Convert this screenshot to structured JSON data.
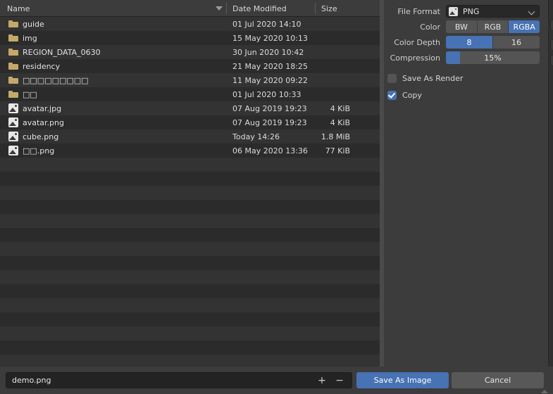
{
  "file_list": {
    "columns": {
      "name": "Name",
      "date_modified": "Date Modified",
      "size": "Size",
      "sort_icon": "sort-descending-triangle-icon"
    },
    "items": [
      {
        "icon": "folder-icon",
        "name": "guide",
        "date": "01 Jul 2020 14:10",
        "size": ""
      },
      {
        "icon": "folder-icon",
        "name": "img",
        "date": "15 May 2020 10:13",
        "size": ""
      },
      {
        "icon": "folder-icon",
        "name": "REGION_DATA_0630",
        "date": "30 Jun 2020 10:42",
        "size": ""
      },
      {
        "icon": "folder-icon",
        "name": "residency",
        "date": "21 May 2020 18:25",
        "size": ""
      },
      {
        "icon": "folder-icon",
        "name": "□□□□□□□□□",
        "date": "11 May 2020 09:22",
        "size": ""
      },
      {
        "icon": "folder-icon",
        "name": "□□",
        "date": "01 Jul 2020 10:33",
        "size": ""
      },
      {
        "icon": "image-icon",
        "name": "avatar.jpg",
        "date": "07 Aug 2019 19:23",
        "size": "4 KiB"
      },
      {
        "icon": "image-icon",
        "name": "avatar.png",
        "date": "07 Aug 2019 19:23",
        "size": "4 KiB"
      },
      {
        "icon": "image-icon",
        "name": "cube.png",
        "date": "Today 14:26",
        "size": "1.8 MiB"
      },
      {
        "icon": "image-icon",
        "name": "□□.png",
        "date": "06 May 2020 13:36",
        "size": "77 KiB"
      }
    ],
    "empty_row_count": 15
  },
  "properties": {
    "file_format": {
      "label": "File Format",
      "value": "PNG",
      "icon": "image-icon",
      "chevron": "chevron-down-icon"
    },
    "color": {
      "label": "Color",
      "options": [
        "BW",
        "RGB",
        "RGBA"
      ],
      "selected": "RGBA"
    },
    "color_depth": {
      "label": "Color Depth",
      "options": [
        "8",
        "16"
      ],
      "selected": "8"
    },
    "compression": {
      "label": "Compression",
      "value": "15%",
      "percent": 15
    },
    "save_as_render": {
      "label": "Save As Render",
      "checked": false
    },
    "copy": {
      "label": "Copy",
      "checked": true
    }
  },
  "bottom_bar": {
    "filename": "demo.png",
    "increment_icon": "+",
    "decrement_icon": "−",
    "confirm_label": "Save As Image",
    "cancel_label": "Cancel"
  },
  "colors": {
    "accent_blue": "#4772b3",
    "panel_bg": "#3c3c3c",
    "list_bg": "#303030",
    "row_odd": "#333333",
    "row_even": "#2b2b2b",
    "field_bg": "#232323",
    "folder_icon": "#c5a968",
    "widget_gray": "#545454"
  }
}
